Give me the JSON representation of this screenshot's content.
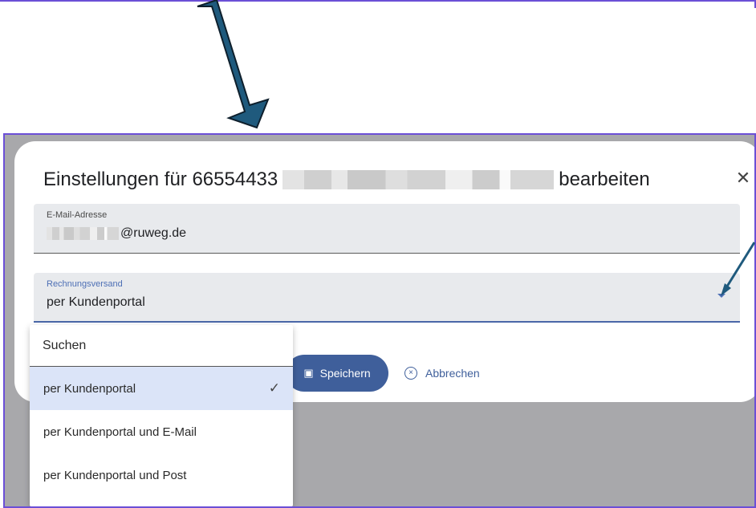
{
  "dialog": {
    "title_prefix": "Einstellungen für 66554433",
    "title_suffix": "bearbeiten",
    "close_icon": "close-icon",
    "email_field": {
      "label": "E-Mail-Adresse",
      "value_suffix": "@ruweg.de"
    },
    "invoice_field": {
      "label": "Rechnungsversand",
      "value": "per Kundenportal"
    },
    "save_label": "Speichern",
    "cancel_label": "Abbrechen"
  },
  "dropdown": {
    "search_label": "Suchen",
    "options": [
      {
        "label": "per Kundenportal",
        "selected": true
      },
      {
        "label": "per Kundenportal und E-Mail",
        "selected": false
      },
      {
        "label": "per Kundenportal und Post",
        "selected": false
      }
    ]
  },
  "colors": {
    "accent": "#3f5f9b",
    "frame": "#6b4fd6",
    "arrow": "#1f5a7d",
    "selected_row": "#dbe4f8"
  }
}
